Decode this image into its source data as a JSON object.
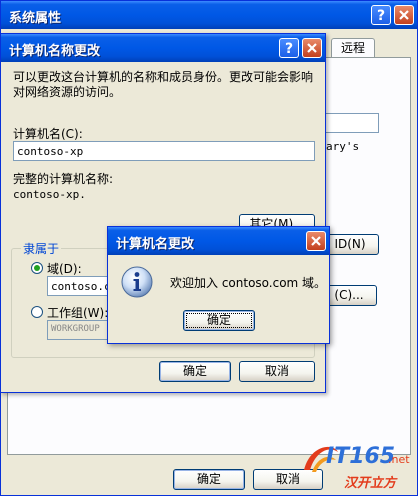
{
  "system_properties": {
    "title": "系统属性",
    "help_btn": "?",
    "tab_remote": "远程",
    "partial_text": "ary's",
    "id_button": "ID(N)",
    "change_button": "(C)...",
    "ok": "确定",
    "cancel": "取消"
  },
  "computer_name_dialog": {
    "title": "计算机名称更改",
    "help_btn": "?",
    "description": "可以更改这台计算机的名称和成员身份。更改可能会影响对网络资源的访问。",
    "computer_name_label": "计算机名(C):",
    "computer_name_value": "contoso-xp",
    "full_name_label": "完整的计算机名称:",
    "full_name_value": "contoso-xp.",
    "other_button": "其它(M)...",
    "member_of": "隶属于",
    "domain_label": "域(D):",
    "domain_value": "contoso.co",
    "workgroup_label": "工作组(W):",
    "workgroup_value": "WORKGROUP",
    "ok": "确定",
    "cancel": "取消"
  },
  "welcome_dialog": {
    "title": "计算机名更改",
    "message": "欢迎加入 contoso.com 域。",
    "ok": "确定"
  },
  "watermark": {
    "brand": "IT165",
    "suffix": ".net",
    "sub": "汉开立方"
  }
}
